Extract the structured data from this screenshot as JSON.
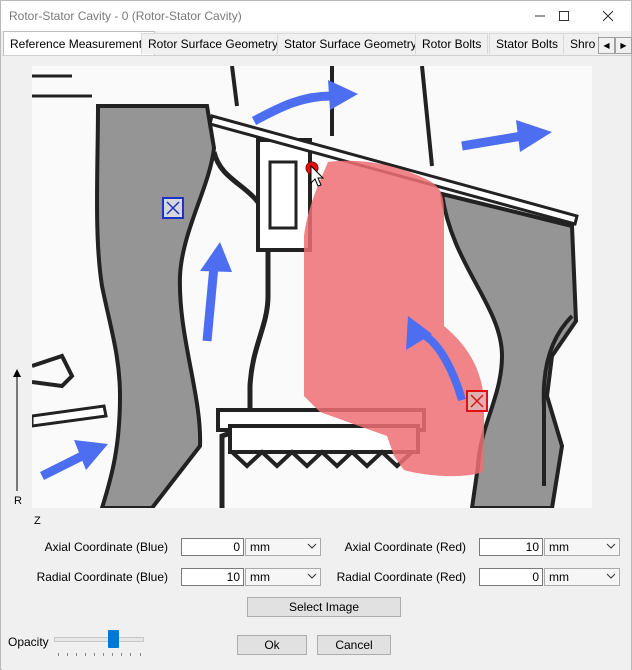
{
  "window": {
    "title": "Rotor-Stator Cavity - 0 (Rotor-Stator Cavity)"
  },
  "tabs": [
    "Reference Measurements",
    "Rotor Surface Geometry",
    "Stator Surface Geometry",
    "Rotor Bolts",
    "Stator Bolts",
    "Shro"
  ],
  "axes": {
    "r_label": "R",
    "z_label": "Z"
  },
  "fields": {
    "axial_blue": {
      "label": "Axial Coordinate (Blue)",
      "value": "0",
      "unit": "mm"
    },
    "radial_blue": {
      "label": "Radial Coordinate (Blue)",
      "value": "10",
      "unit": "mm"
    },
    "axial_red": {
      "label": "Axial Coordinate (Red)",
      "value": "10",
      "unit": "mm"
    },
    "radial_red": {
      "label": "Radial Coordinate (Red)",
      "value": "0",
      "unit": "mm"
    }
  },
  "buttons": {
    "select_image": "Select Image",
    "ok": "Ok",
    "cancel": "Cancel"
  },
  "opacity": {
    "label": "Opacity",
    "level": 0.68
  },
  "colors": {
    "accent": "#0078d7",
    "marker_blue": "#1a33cc",
    "marker_red": "#e01010",
    "arrow": "#4d6ef0",
    "region_red": "#ef6f73"
  }
}
